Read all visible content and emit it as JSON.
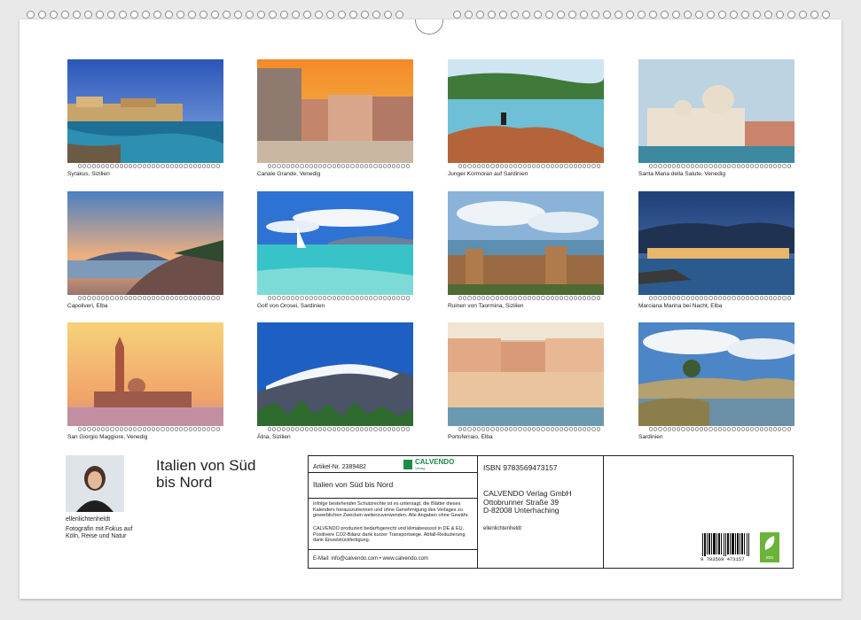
{
  "photos": [
    {
      "caption": "Syrakus, Sizilien"
    },
    {
      "caption": "Canale Grande, Venedig"
    },
    {
      "caption": "Junger Kormoran auf Sardinien"
    },
    {
      "caption": "Santa Maria della Salute, Venedig"
    },
    {
      "caption": "Capoliveri, Elba"
    },
    {
      "caption": "Golf von Orosei, Sardinien"
    },
    {
      "caption": "Ruinen von Taormina, Sizilien"
    },
    {
      "caption": "Marciana Marina bei Nacht, Elba"
    },
    {
      "caption": "San Giorgio Maggiore, Venedig"
    },
    {
      "caption": "Ätna, Sizilien"
    },
    {
      "caption": "Portoferraio, Elba"
    },
    {
      "caption": "Sardinien"
    }
  ],
  "calendar": {
    "title_line1": "Italien von Süd",
    "title_line2": "bis Nord"
  },
  "author": {
    "name": "ellenlichtenheldt",
    "bio_line1": "Fotografin mit Fokus auf",
    "bio_line2": "Köln, Reise und Natur"
  },
  "imprint": {
    "article_no": "Artikel-Nr. 2389482",
    "product_title": "Italien von Süd bis Nord",
    "brand": "CALVENDO",
    "brand_sub": "Verlag",
    "copyright_text": "Infolge bestehender Schutzrechte ist es untersagt, die Blätter dieses Kalenders herauszutrennen und ohne Genehmigung des Verlages zu gewerblichen Zwecken weiterzuverwenden. Alle Angaben ohne Gewähr.",
    "eco_text": "CALVENDO produziert bedarfsgerecht und klimabewusst in DE & EU. Positivere CO2-Bilanz dank kurzer Transportwege. Abfall-Reduzierung dank Einzelstückfertigung.",
    "contact": "E-Mail: info@calvendo.com • www.calvendo.com",
    "isbn": "ISBN 9783569473157",
    "publisher_line1": "CALVENDO Verlag GmbH",
    "publisher_line2": "Ottobrunner Straße 39",
    "publisher_line3": "D-82008 Unterhaching",
    "photographer": "ellenlichtenheldt",
    "barcode_digits": "9 783569 473157",
    "eco_badge": "eco"
  },
  "colors": {
    "calvendo_green": "#1d8b4a",
    "eco_green": "#6bb33a"
  }
}
